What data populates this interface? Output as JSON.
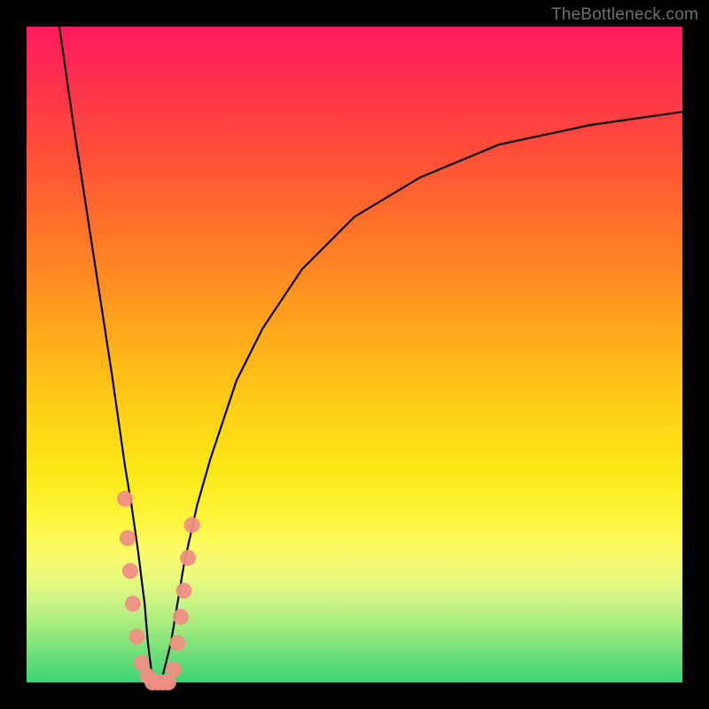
{
  "watermark": "TheBottleneck.com",
  "chart_data": {
    "type": "line",
    "title": "",
    "xlabel": "",
    "ylabel": "",
    "xlim": [
      0,
      100
    ],
    "ylim": [
      0,
      100
    ],
    "grid": false,
    "legend": false,
    "background_gradient": {
      "direction": "vertical",
      "stops": [
        {
          "pos": 0,
          "color": "#ff1a5e"
        },
        {
          "pos": 18,
          "color": "#ff4a3a"
        },
        {
          "pos": 38,
          "color": "#ff8a22"
        },
        {
          "pos": 58,
          "color": "#ffce15"
        },
        {
          "pos": 75,
          "color": "#fdf53a"
        },
        {
          "pos": 88,
          "color": "#c8f484"
        },
        {
          "pos": 100,
          "color": "#3cd574"
        }
      ]
    },
    "series": [
      {
        "name": "bottleneck-curve",
        "description": "V-shaped curve. x is normalized resource index (0-100), y is bottleneck percentage (0-100). Sharp minimum near x≈20.",
        "x": [
          5,
          7,
          9,
          11,
          13,
          15,
          16,
          17,
          18,
          18.5,
          19,
          19.5,
          20,
          20.5,
          21,
          22,
          23,
          24,
          26,
          28,
          32,
          36,
          42,
          50,
          60,
          72,
          86,
          100
        ],
        "y": [
          100,
          86,
          73,
          60,
          47,
          33,
          27,
          20,
          12,
          6,
          2,
          0,
          0,
          0,
          2,
          6,
          12,
          18,
          27,
          34,
          46,
          54,
          63,
          71,
          77,
          82,
          85,
          87
        ]
      }
    ],
    "markers": {
      "name": "sample-points",
      "description": "Light coral dots clustered near the curve minimum on both arms and along the floor.",
      "points": [
        {
          "x": 15.0,
          "y": 28
        },
        {
          "x": 15.4,
          "y": 22
        },
        {
          "x": 15.8,
          "y": 17
        },
        {
          "x": 16.2,
          "y": 12
        },
        {
          "x": 16.8,
          "y": 7
        },
        {
          "x": 17.5,
          "y": 3
        },
        {
          "x": 18.4,
          "y": 1
        },
        {
          "x": 19.2,
          "y": 0
        },
        {
          "x": 20.0,
          "y": 0
        },
        {
          "x": 20.8,
          "y": 0
        },
        {
          "x": 21.6,
          "y": 0
        },
        {
          "x": 22.4,
          "y": 2
        },
        {
          "x": 23.0,
          "y": 6
        },
        {
          "x": 23.5,
          "y": 10
        },
        {
          "x": 24.0,
          "y": 14
        },
        {
          "x": 24.6,
          "y": 19
        },
        {
          "x": 25.2,
          "y": 24
        }
      ],
      "radius_px": 9
    }
  }
}
